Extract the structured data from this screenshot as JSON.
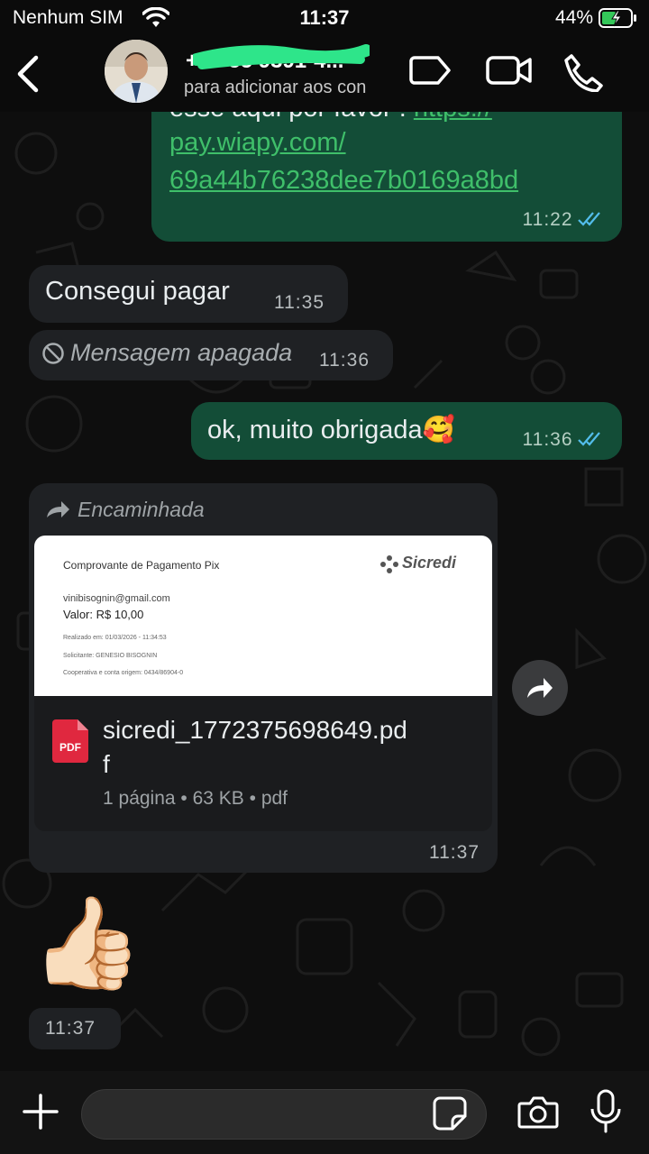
{
  "status_bar": {
    "carrier": "Nenhum SIM",
    "time": "11:37",
    "battery": "44%"
  },
  "header": {
    "contact_name": "+55 55 9391-4...",
    "contact_subtitle": "para adicionar aos con",
    "icons": [
      "back-chevron-icon",
      "label-tag-icon",
      "video-call-icon",
      "voice-call-icon"
    ]
  },
  "messages": [
    {
      "direction": "outgoing",
      "text_partial": "esse aqui por favor :",
      "link_1": "https://",
      "link_2": "pay.wiapy.com/",
      "link_3": "69a44b76238dee7b0169a8bd",
      "time": "11:22",
      "status": "read"
    },
    {
      "direction": "incoming",
      "text": "Consegui pagar",
      "time": "11:35"
    },
    {
      "direction": "incoming",
      "deleted_text": "Mensagem apagada",
      "time": "11:36"
    },
    {
      "direction": "outgoing",
      "text": "ok, muito obrigada🥰",
      "time": "11:36",
      "status": "read"
    },
    {
      "direction": "incoming",
      "forwarded_label": "Encaminhada",
      "preview": {
        "title": "Comprovante de Pagamento Pix",
        "brand": "Sicredi",
        "email": "vinibisognin@gmail.com",
        "amount": "Valor: R$ 10,00",
        "line_1": "Realizado em: 01/03/2026 - 11:34:53",
        "line_2": "Solicitante: GENESIO BISOGNIN",
        "line_3": "Cooperativa e conta origem: 0434/86904-0"
      },
      "file_badge": "PDF",
      "file_name_line1": "sicredi_1772375698649.pd",
      "file_name_line2": "f",
      "file_meta": "1 página • 63 KB • pdf",
      "time": "11:37"
    },
    {
      "direction": "incoming",
      "emoji": "👍🏻",
      "time": "11:37"
    }
  ],
  "colors": {
    "outgoing_bubble": "#134d37",
    "incoming_bubble": "#1f2124",
    "read_ticks": "#53bdeb",
    "link": "#3fbf6a"
  }
}
